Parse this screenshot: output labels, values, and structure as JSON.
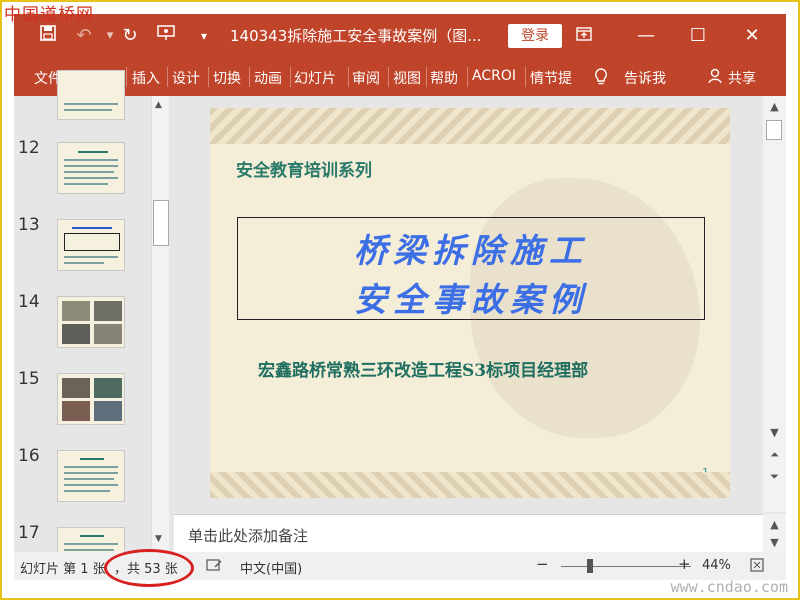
{
  "watermark": {
    "top_left": "中国道桥网",
    "bottom_right": "www.cndao.com"
  },
  "titlebar": {
    "title": "140343拆除施工安全事故案例（图...",
    "login_label": "登录",
    "icons": [
      "save-icon",
      "undo-icon",
      "redo-icon",
      "present-icon",
      "customize-icon",
      "ribbon-display-icon",
      "minimize-icon",
      "maximize-icon",
      "close-icon"
    ]
  },
  "ribbon": {
    "tabs": [
      "文件",
      "开始",
      "插入",
      "设计",
      "切换",
      "动画",
      "幻灯片",
      "审阅",
      "视图",
      "帮助",
      "ACROI",
      "情节提",
      "告诉我",
      "共享"
    ]
  },
  "thumbnails": [
    {
      "num": "12"
    },
    {
      "num": "13"
    },
    {
      "num": "14"
    },
    {
      "num": "15"
    },
    {
      "num": "16"
    },
    {
      "num": "17"
    }
  ],
  "slide": {
    "series": "安全教育培训系列",
    "title_line1": "桥梁拆除施工",
    "title_line2": "安全事故案例",
    "org": "宏鑫路桥常熟三环改造工程S3标项目经理部",
    "page_number": "1"
  },
  "notes": {
    "placeholder": "单击此处添加备注"
  },
  "statusbar": {
    "slide_label": "幻灯片 第 1 张",
    "total_label": "，共 53 张",
    "language": "中文(中国)",
    "zoom": "44%"
  },
  "colors": {
    "accent": "#c0442a",
    "title_blue": "#3c6ee6",
    "teal": "#2a7a6a",
    "highlight": "#d82020"
  }
}
